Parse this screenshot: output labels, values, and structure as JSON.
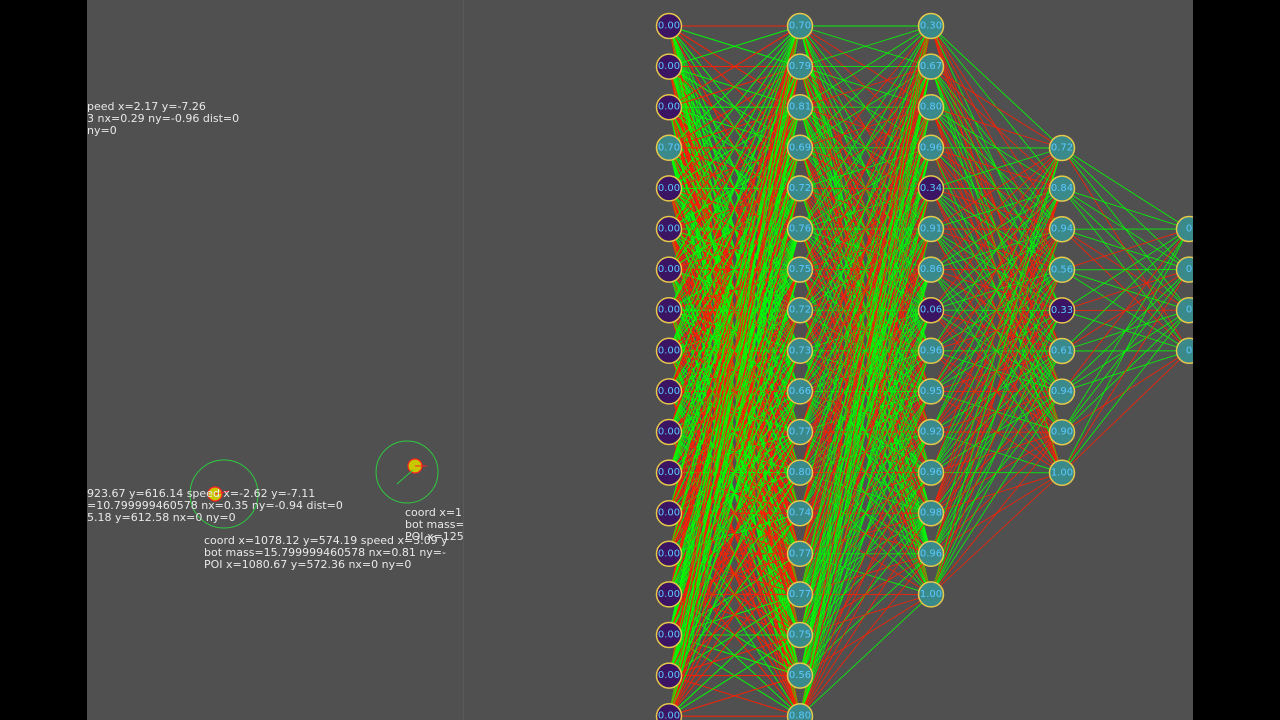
{
  "colors": {
    "background": "#505050",
    "text": "#e8e8e8",
    "ring": "#2ecc40",
    "bot_fill": "#c8c800",
    "bot_outline": "#ff2020",
    "node_dark": "#3c1464",
    "node_teal": "#3a8a8c",
    "node_outline": "#e6c84a",
    "node_text": "#5cc8ff",
    "positive_weight": "#00ff00",
    "negative_weight": "#ff2000"
  },
  "simulation": {
    "bots": [
      {
        "lines": [
          "peed x=2.17 y=-7.26",
          "3 nx=0.29 ny=-0.96 dist=0",
          "ny=0"
        ]
      },
      {
        "lines": [
          "923.67 y=616.14 speed x=-2.62 y=-7.11",
          "=10.799999460578 nx=0.35 ny=-0.94 dist=0",
          "5.18 y=612.58 nx=0 ny=0"
        ]
      },
      {
        "lines": [
          "coord x=1078.12 y=574.19 speed x=3.09 y",
          "bot mass=15.799999460578 nx=0.81 ny=-",
          "POI x=1080.67 y=572.36 nx=0 ny=0"
        ]
      },
      {
        "lines": [
          "coord x=1",
          "bot mass=",
          "POI x=125"
        ]
      }
    ]
  },
  "network": {
    "layers": [
      {
        "name": "input",
        "nodes": [
          {
            "value": "0.00",
            "active": false
          },
          {
            "value": "0.00",
            "active": false
          },
          {
            "value": "0.00",
            "active": false
          },
          {
            "value": "0.70",
            "active": true
          },
          {
            "value": "0.00",
            "active": false
          },
          {
            "value": "0.00",
            "active": false
          },
          {
            "value": "0.00",
            "active": false
          },
          {
            "value": "0.00",
            "active": false
          },
          {
            "value": "0.00",
            "active": false
          },
          {
            "value": "0.00",
            "active": false
          },
          {
            "value": "0.00",
            "active": false
          },
          {
            "value": "0.00",
            "active": false
          },
          {
            "value": "0.00",
            "active": false
          },
          {
            "value": "0.00",
            "active": false
          },
          {
            "value": "0.00",
            "active": false
          },
          {
            "value": "0.00",
            "active": false
          },
          {
            "value": "0.00",
            "active": false
          },
          {
            "value": "0.00",
            "active": false
          }
        ]
      },
      {
        "name": "hidden1",
        "nodes": [
          {
            "value": "0.70",
            "active": true
          },
          {
            "value": "0.79",
            "active": true
          },
          {
            "value": "0.81",
            "active": true
          },
          {
            "value": "0.69",
            "active": true
          },
          {
            "value": "0.72",
            "active": true
          },
          {
            "value": "0.76",
            "active": true
          },
          {
            "value": "0.75",
            "active": true
          },
          {
            "value": "0.72",
            "active": true
          },
          {
            "value": "0.73",
            "active": true
          },
          {
            "value": "0.66",
            "active": true
          },
          {
            "value": "0.77",
            "active": true
          },
          {
            "value": "0.80",
            "active": true
          },
          {
            "value": "0.74",
            "active": true
          },
          {
            "value": "0.77",
            "active": true
          },
          {
            "value": "0.77",
            "active": true
          },
          {
            "value": "0.75",
            "active": true
          },
          {
            "value": "0.56",
            "active": true
          },
          {
            "value": "0.80",
            "active": true
          }
        ]
      },
      {
        "name": "hidden2",
        "nodes": [
          {
            "value": "0.30",
            "active": true
          },
          {
            "value": "0.67",
            "active": true
          },
          {
            "value": "0.80",
            "active": true
          },
          {
            "value": "0.96",
            "active": true
          },
          {
            "value": "0.34",
            "active": false
          },
          {
            "value": "0.91",
            "active": true
          },
          {
            "value": "0.86",
            "active": true
          },
          {
            "value": "0.06",
            "active": false
          },
          {
            "value": "0.96",
            "active": true
          },
          {
            "value": "0.95",
            "active": true
          },
          {
            "value": "0.92",
            "active": true
          },
          {
            "value": "0.96",
            "active": true
          },
          {
            "value": "0.98",
            "active": true
          },
          {
            "value": "0.96",
            "active": true
          },
          {
            "value": "1.00",
            "active": true
          }
        ]
      },
      {
        "name": "hidden3",
        "nodes": [
          {
            "value": "0.72",
            "active": true
          },
          {
            "value": "0.84",
            "active": true
          },
          {
            "value": "0.94",
            "active": true
          },
          {
            "value": "0.56",
            "active": true
          },
          {
            "value": "0.33",
            "active": false
          },
          {
            "value": "0.61",
            "active": true
          },
          {
            "value": "0.94",
            "active": true
          },
          {
            "value": "0.90",
            "active": true
          },
          {
            "value": "1.00",
            "active": true
          }
        ]
      },
      {
        "name": "output",
        "nodes": [
          {
            "value": "0",
            "active": true
          },
          {
            "value": "0",
            "active": true
          },
          {
            "value": "0",
            "active": true
          },
          {
            "value": "0",
            "active": true
          }
        ]
      }
    ]
  }
}
